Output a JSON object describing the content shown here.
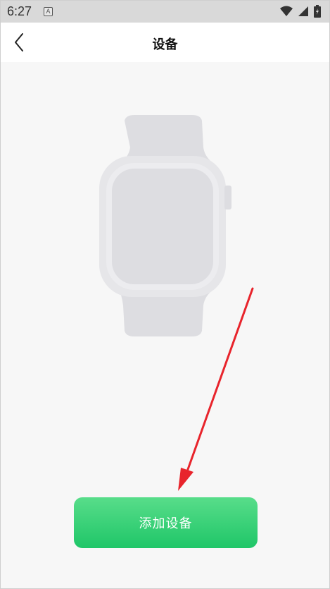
{
  "status_bar": {
    "time": "6:27",
    "notification_glyph": "A",
    "icons": [
      "wifi-icon",
      "signal-icon",
      "battery-icon"
    ]
  },
  "header": {
    "title": "设备",
    "back_icon": "chevron-left-icon"
  },
  "main": {
    "illustration": "smartwatch-icon",
    "add_device_label": "添加设备"
  },
  "colors": {
    "button_gradient_top": "#58dd8a",
    "button_gradient_bottom": "#1fc668",
    "arrow": "#e8242c",
    "watch_body": "#dddde1"
  }
}
